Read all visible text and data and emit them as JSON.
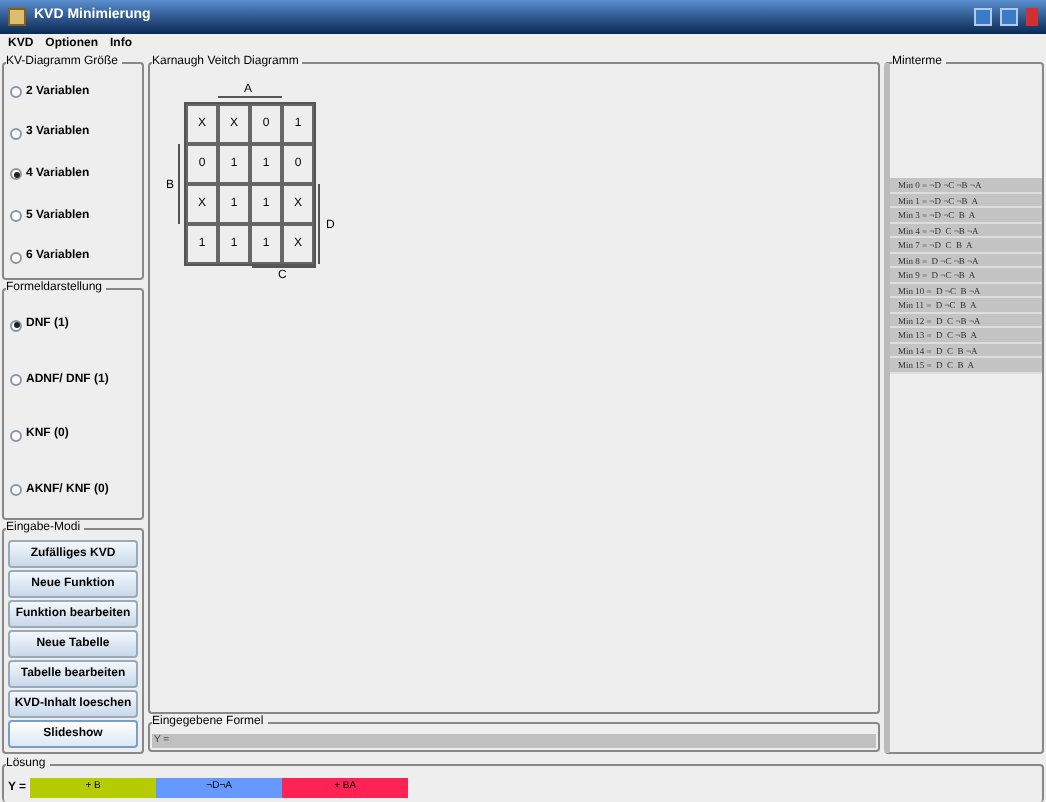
{
  "window": {
    "title": "KVD Minimierung"
  },
  "menu": [
    "KVD",
    "Optionen",
    "Info"
  ],
  "size_group": {
    "title": "KV-Diagramm Größe",
    "options": [
      {
        "label": "2 Variablen",
        "selected": false
      },
      {
        "label": "3 Variablen",
        "selected": false
      },
      {
        "label": "4 Variablen",
        "selected": true
      },
      {
        "label": "5 Variablen",
        "selected": false
      },
      {
        "label": "6 Variablen",
        "selected": false
      }
    ]
  },
  "format_group": {
    "title": "Formeldarstellung",
    "options": [
      {
        "label": "DNF (1)",
        "selected": true
      },
      {
        "label": "ADNF/ DNF (1)",
        "selected": false
      },
      {
        "label": "KNF (0)",
        "selected": false
      },
      {
        "label": "AKNF/ KNF (0)",
        "selected": false
      }
    ]
  },
  "input_group": {
    "title": "Eingabe-Modi",
    "buttons": [
      {
        "label": "Zufälliges KVD",
        "focused": false
      },
      {
        "label": "Neue Funktion",
        "focused": false
      },
      {
        "label": "Funktion bearbeiten",
        "focused": false
      },
      {
        "label": "Neue Tabelle",
        "focused": false
      },
      {
        "label": "Tabelle bearbeiten",
        "focused": false
      },
      {
        "label": "KVD-Inhalt loeschen",
        "focused": false
      },
      {
        "label": "Slideshow",
        "focused": true
      }
    ]
  },
  "kv_diagram": {
    "title": "Karnaugh Veitch Diagramm",
    "labels": {
      "top": "A",
      "left": "B",
      "right": "D",
      "bottom": "C"
    },
    "cells": [
      [
        "X",
        "X",
        "0",
        "1"
      ],
      [
        "0",
        "1",
        "1",
        "0"
      ],
      [
        "X",
        "1",
        "1",
        "X"
      ],
      [
        "1",
        "1",
        "1",
        "X"
      ]
    ]
  },
  "formula": {
    "title": "Eingegebene Formel",
    "value": "Y ="
  },
  "minterms": {
    "title": "Minterme",
    "items": [
      "Min 0 = ¬D ¬C ¬B ¬A",
      "Min 1 = ¬D ¬C ¬B  A",
      "Min 3 = ¬D ¬C  B  A",
      "Min 4 = ¬D  C ¬B ¬A",
      "Min 7 = ¬D  C  B  A",
      "Min 8 =  D ¬C ¬B ¬A",
      "Min 9 =  D ¬C ¬B  A",
      "Min 10 =  D ¬C  B ¬A",
      "Min 11 =  D ¬C  B  A",
      "Min 12 =  D  C ¬B ¬A",
      "Min 13 =  D  C ¬B  A",
      "Min 14 =  D  C  B ¬A",
      "Min 15 =  D  C  B  A"
    ]
  },
  "solution": {
    "title": "Lösung",
    "prefix": "Y =",
    "terms": [
      {
        "text": "+ B",
        "color": "#b5cc00"
      },
      {
        "text": "¬D¬A",
        "color": "#6699ff"
      },
      {
        "text": "+ BA",
        "color": "#ff2255"
      }
    ]
  }
}
